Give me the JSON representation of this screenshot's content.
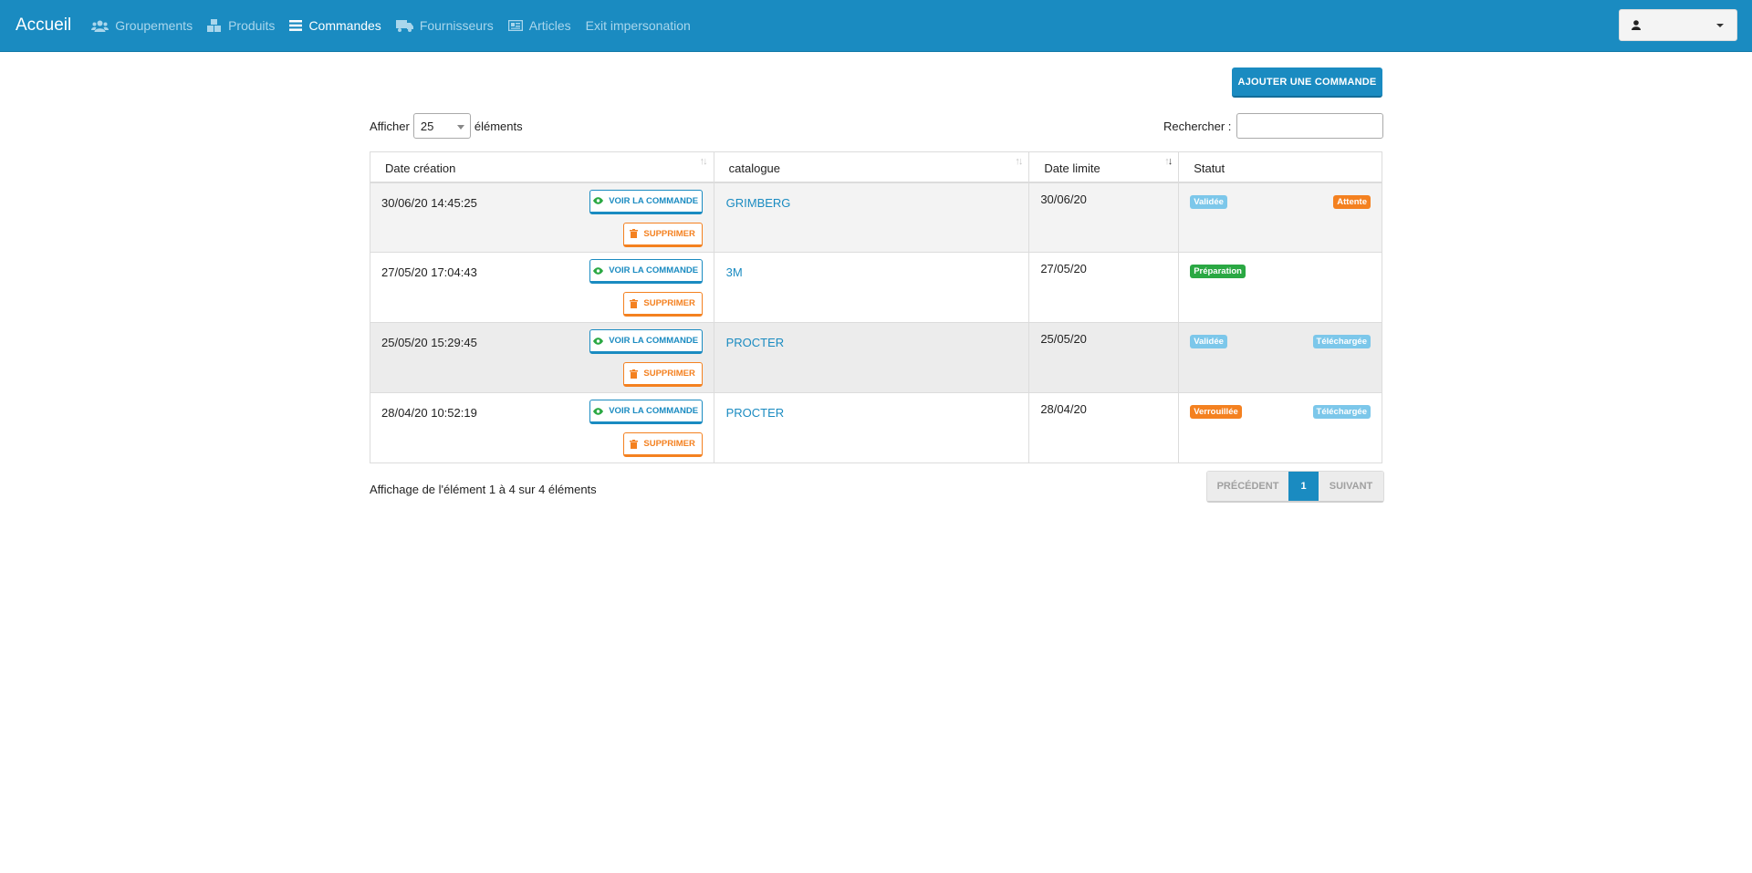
{
  "nav": {
    "brand": "Accueil",
    "items": [
      {
        "label": "Groupements",
        "icon": "users-icon",
        "active": false
      },
      {
        "label": "Produits",
        "icon": "cubes-icon",
        "active": false
      },
      {
        "label": "Commandes",
        "icon": "list-icon",
        "active": true
      },
      {
        "label": "Fournisseurs",
        "icon": "truck-icon",
        "active": false
      },
      {
        "label": "Articles",
        "icon": "newspaper-icon",
        "active": false
      },
      {
        "label": "Exit impersonation",
        "icon": "",
        "active": false
      }
    ],
    "user_icon": "user-icon"
  },
  "actions": {
    "add_label": "AJOUTER UNE COMMANDE"
  },
  "length": {
    "prefix": "Afficher",
    "value": "25",
    "suffix": "éléments"
  },
  "search": {
    "label": "Rechercher :",
    "value": ""
  },
  "table": {
    "headers": [
      "Date création",
      "catalogue",
      "Date limite",
      "Statut"
    ],
    "view_label": "VOIR LA COMMANDE",
    "delete_label": "SUPPRIMER",
    "rows": [
      {
        "created": "30/06/20 14:45:25",
        "catalogue": "GRIMBERG",
        "limit": "30/06/20",
        "status_left": {
          "label": "Validée",
          "color": "#7cc7ea"
        },
        "status_right": {
          "label": "Attente",
          "color": "#f48120"
        }
      },
      {
        "created": "27/05/20 17:04:43",
        "catalogue": "3M",
        "limit": "27/05/20",
        "status_left": {
          "label": "Préparation",
          "color": "#2aa843"
        },
        "status_right": null
      },
      {
        "created": "25/05/20 15:29:45",
        "catalogue": "PROCTER",
        "limit": "25/05/20",
        "status_left": {
          "label": "Validée",
          "color": "#7cc7ea"
        },
        "status_right": {
          "label": "Téléchargée",
          "color": "#7cc7ea"
        }
      },
      {
        "created": "28/04/20 10:52:19",
        "catalogue": "PROCTER",
        "limit": "28/04/20",
        "status_left": {
          "label": "Verrouillée",
          "color": "#f48120"
        },
        "status_right": {
          "label": "Téléchargée",
          "color": "#7cc7ea"
        }
      }
    ]
  },
  "footer": {
    "info": "Affichage de l'élément 1 à 4 sur 4 éléments",
    "prev": "PRÉCÉDENT",
    "page": "1",
    "next": "SUIVANT"
  },
  "colors": {
    "primary": "#1a8bc1",
    "danger": "#f48120",
    "info": "#7cc7ea",
    "success": "#2aa843"
  }
}
